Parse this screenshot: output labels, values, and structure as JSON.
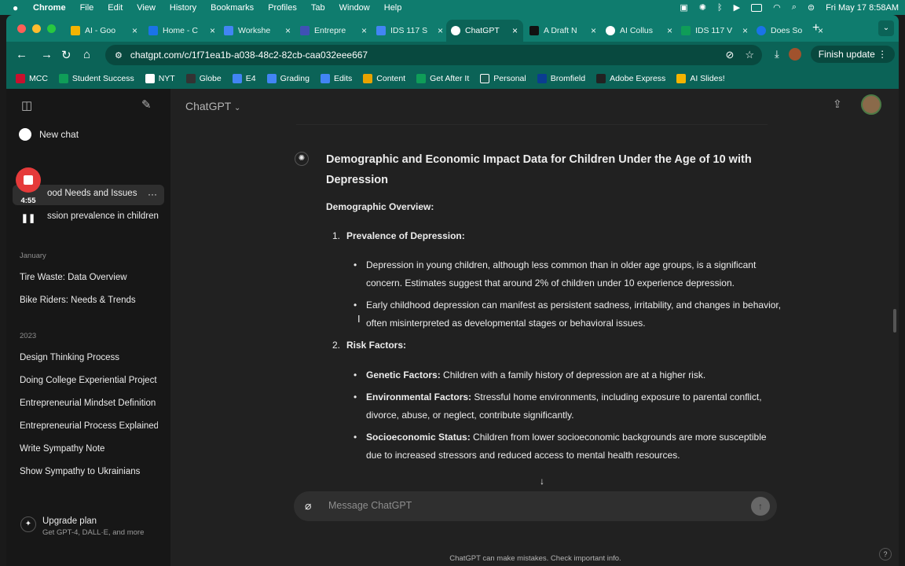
{
  "menubar": {
    "app": "Chrome",
    "items": [
      "File",
      "Edit",
      "View",
      "History",
      "Bookmarks",
      "Profiles",
      "Tab",
      "Window",
      "Help"
    ],
    "clock": "Fri May 17  8:58AM"
  },
  "tabs": [
    {
      "label": "AI - Goo",
      "color": "#f4b400"
    },
    {
      "label": "Home - C",
      "color": "#1a73e8"
    },
    {
      "label": "Workshe",
      "color": "#4285f4"
    },
    {
      "label": "Entrepre",
      "color": "#3f51b5"
    },
    {
      "label": "IDS 117 S",
      "color": "#4285f4"
    },
    {
      "label": "ChatGPT",
      "color": "#ffffff"
    },
    {
      "label": "A Draft N",
      "color": "#111111"
    },
    {
      "label": "AI Collus",
      "color": "#ffffff"
    },
    {
      "label": "IDS 117 V",
      "color": "#0f9d58"
    },
    {
      "label": "Does So",
      "color": "#1a73e8"
    }
  ],
  "toolbar": {
    "url": "chatgpt.com/c/1f71ea1b-a038-48c2-82cb-caa032eee667",
    "finish_update": "Finish update"
  },
  "bookmarks": [
    {
      "label": "MCC",
      "color": "#c8102e"
    },
    {
      "label": "Student Success",
      "color": "#0f9d58"
    },
    {
      "label": "NYT",
      "color": "#ffffff"
    },
    {
      "label": "Globe",
      "color": "#333333"
    },
    {
      "label": "E4",
      "color": "#4285f4"
    },
    {
      "label": "Grading",
      "color": "#4285f4"
    },
    {
      "label": "Edits",
      "color": "#4285f4"
    },
    {
      "label": "Content",
      "color": "#e8a300"
    },
    {
      "label": "Get After It",
      "color": "#0f9d58"
    },
    {
      "label": "Personal",
      "color": "#1a5c52"
    },
    {
      "label": "Bromfield",
      "color": "#0b3d91"
    },
    {
      "label": "Adobe Express",
      "color": "#222222"
    },
    {
      "label": "AI Slides!",
      "color": "#f4b400"
    }
  ],
  "sidebar": {
    "new_chat": "New chat",
    "recorder_time": "4:55",
    "partial_items": [
      "ood Needs and Issues",
      "ssion prevalence in children..."
    ],
    "section_january": "January",
    "january_items": [
      "Tire Waste: Data Overview",
      "Bike Riders: Needs & Trends"
    ],
    "section_2023": "2023",
    "items_2023": [
      "Design Thinking Process",
      "Doing College Experiential Project",
      "Entrepreneurial Mindset Definition",
      "Entrepreneurial Process Explained",
      "Write Sympathy Note",
      "Show Sympathy to Ukrainians"
    ],
    "upgrade_title": "Upgrade plan",
    "upgrade_sub": "Get GPT-4, DALL·E, and more"
  },
  "main": {
    "model": "ChatGPT",
    "title": "Demographic and Economic Impact Data for Children Under the Age of 10 with Depression",
    "overview": "Demographic Overview:",
    "section1": {
      "num": "1.",
      "label": "Prevalence of Depression:",
      "bullets": [
        "Depression in young children, although less common than in older age groups, is a significant concern. Estimates suggest that around 2% of children under 10 experience depression.",
        "Early childhood depression can manifest as persistent sadness, irritability, and changes in behavior, often misinterpreted as developmental stages or behavioral issues."
      ]
    },
    "section2": {
      "num": "2.",
      "label": "Risk Factors:",
      "bullets": [
        {
          "bold": "Genetic Factors:",
          "text": " Children with a family history of depression are at a higher risk."
        },
        {
          "bold": "Environmental Factors:",
          "text": " Stressful home environments, including exposure to parental conflict, divorce, abuse, or neglect, contribute significantly."
        },
        {
          "bold": "Socioeconomic Status:",
          "text": " Children from lower socioeconomic backgrounds are more susceptible due to increased stressors and reduced access to mental health resources."
        }
      ]
    },
    "composer_placeholder": "Message ChatGPT",
    "disclaimer": "ChatGPT can make mistakes. Check important info.",
    "help": "?"
  }
}
